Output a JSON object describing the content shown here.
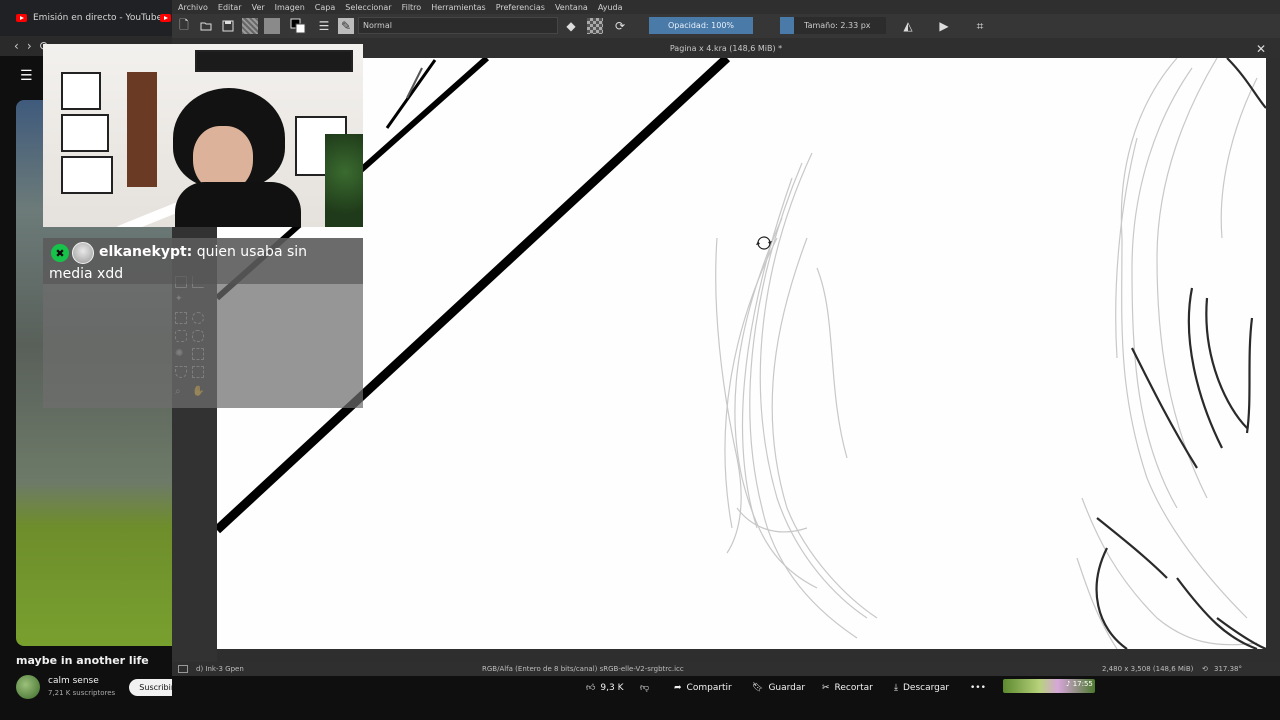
{
  "browser": {
    "tab1_title": "Emisión en directo - YouTube",
    "nav_back": "‹",
    "nav_forward": "›",
    "nav_reload": "⟳"
  },
  "youtube": {
    "video_title": "maybe in another life",
    "channel_name": "calm sense",
    "channel_subs": "7,21 K suscriptores",
    "subscribe_label": "Suscribirme",
    "likes": "9,3 K",
    "share_label": "Compartir",
    "save_label": "Guardar",
    "clip_label": "Recortar",
    "download_label": "Descargar",
    "more_label": "•••",
    "mini_time": "♪ 17:55"
  },
  "krita": {
    "menu": [
      "Archivo",
      "Editar",
      "Ver",
      "Imagen",
      "Capa",
      "Seleccionar",
      "Filtro",
      "Herramientas",
      "Preferencias",
      "Ventana",
      "Ayuda"
    ],
    "blend_mode": "Normal",
    "opacity": "Opacidad: 100%",
    "size": "Tamaño: 2.33 px",
    "document_title": "Pagina x 4.kra (148,6 MiB) *",
    "close": "✕",
    "status_brush": "d) Ink-3 Gpen",
    "status_color": "RGB/Alfa (Entero de 8 bits/canal)  sRGB-elle-V2-srgbtrc.icc",
    "status_size": "2,480 x 3,508 (148,6 MiB)",
    "status_rotation": "317.38°"
  },
  "chat": {
    "username": "elkanekypt:",
    "message": "quien usaba sin media xdd",
    "badge": "✖"
  },
  "colors": {
    "accent_blue": "#4a7aa8",
    "yt_red": "#ff0000",
    "badge_green": "#17c24b"
  }
}
